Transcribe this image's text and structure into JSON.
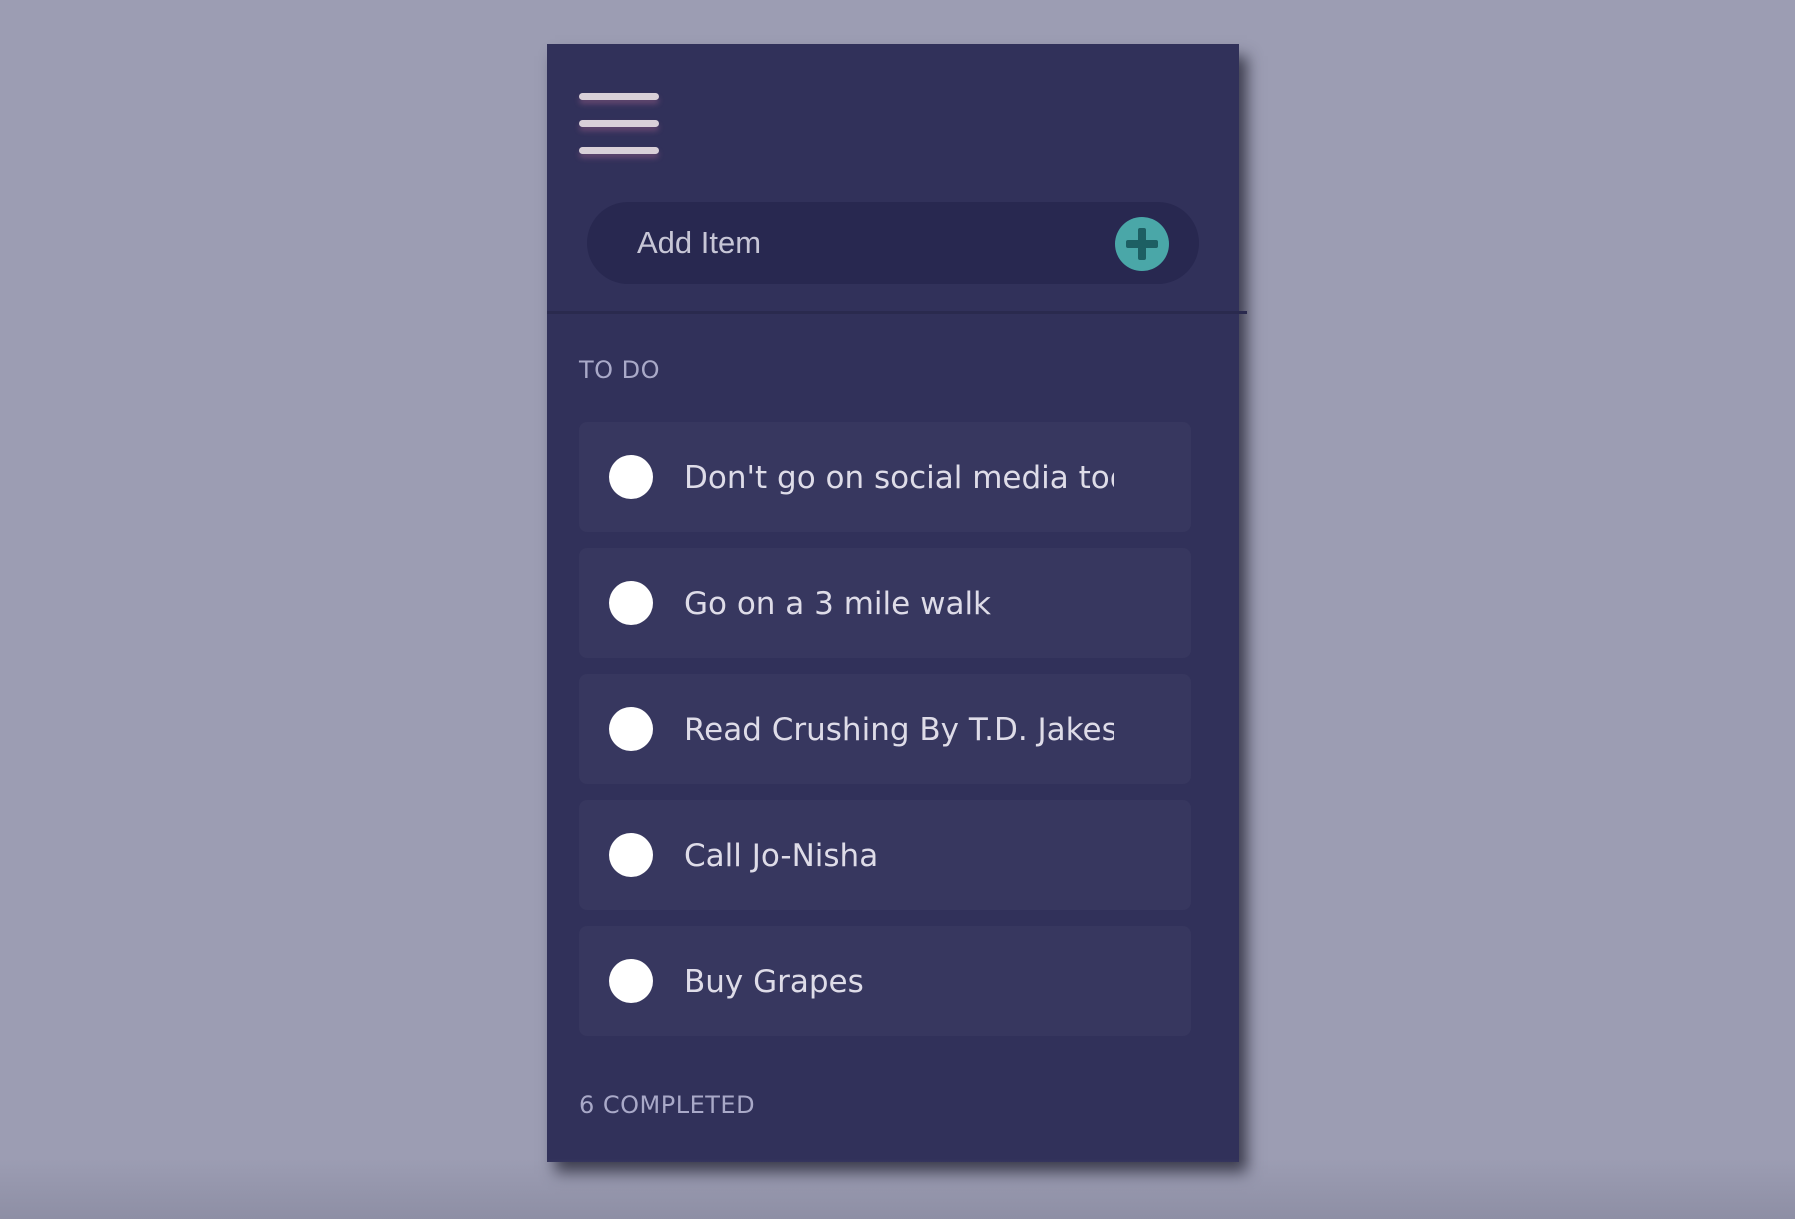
{
  "header": {
    "menu_icon": "hamburger-menu-icon"
  },
  "add_item": {
    "placeholder": "Add Item",
    "button_icon": "plus-icon",
    "button_color": "#4aa7a8"
  },
  "todo": {
    "heading": "TO DO",
    "items": [
      {
        "label": "Don't go on social media today"
      },
      {
        "label": "Go on a 3 mile walk"
      },
      {
        "label": "Read Crushing By T.D. Jakes"
      },
      {
        "label": "Call Jo-Nisha"
      },
      {
        "label": "Buy Grapes"
      }
    ]
  },
  "completed": {
    "heading": "6 COMPLETED"
  },
  "colors": {
    "background": "#9c9db3",
    "panel": "#31315a",
    "item": "#37375f",
    "input": "#282850",
    "accent": "#4aa7a8"
  }
}
